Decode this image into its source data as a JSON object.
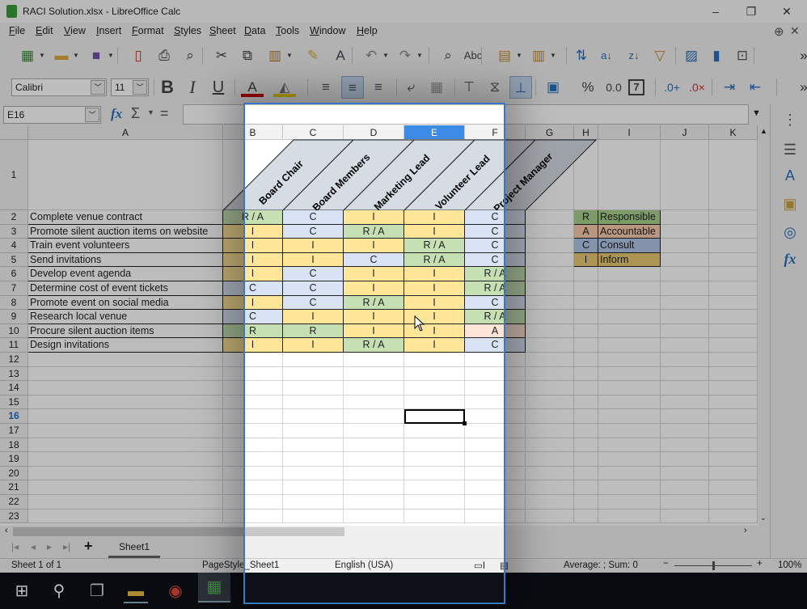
{
  "window": {
    "title": "RACI Solution.xlsx - LibreOffice Calc",
    "minimize": "–",
    "restore": "❐",
    "close": "✕"
  },
  "menu": [
    "File",
    "Edit",
    "View",
    "Insert",
    "Format",
    "Styles",
    "Sheet",
    "Data",
    "Tools",
    "Window",
    "Help"
  ],
  "toolbar1": [
    "new-spreadsheet-icon",
    "open-folder-icon",
    "save-icon",
    "export-pdf-icon",
    "print-icon",
    "print-preview-icon",
    "cut-icon",
    "copy-icon",
    "paste-icon",
    "clone-formatting-icon",
    "clear-formatting-icon",
    "undo-icon",
    "redo-icon",
    "find-replace-icon",
    "spelling-icon",
    "row-icon",
    "column-icon",
    "sort-icon",
    "sort-ascending-icon",
    "sort-descending-icon",
    "autofilter-icon",
    "insert-image-icon",
    "insert-chart-icon",
    "pivot-table-icon",
    "more-icon"
  ],
  "toolbar2": {
    "font_name": "Calibri",
    "font_size": "11",
    "icons": [
      "bold-icon",
      "italic-icon",
      "underline-icon",
      "font-color-icon",
      "highlight-icon",
      "align-left-icon",
      "align-center-icon",
      "align-right-icon",
      "wrap-text-icon",
      "merge-cells-icon",
      "align-top-icon",
      "align-middle-icon",
      "align-bottom-icon",
      "currency-icon",
      "percent-icon",
      "number-format-icon",
      "date-format-icon",
      "add-decimal-icon",
      "delete-decimal-icon",
      "increase-indent-icon",
      "decrease-indent-icon",
      "more-icon"
    ]
  },
  "formula_bar": {
    "cell_ref": "E16",
    "fx": "fx",
    "sum": "Σ",
    "equals": "=",
    "value": ""
  },
  "columns": [
    "A",
    "B",
    "C",
    "D",
    "E",
    "F",
    "G",
    "H",
    "I",
    "J",
    "K"
  ],
  "selected_column": "E",
  "selected_row": "16",
  "active_cell": "E16",
  "row_numbers": [
    "1",
    "2",
    "3",
    "4",
    "5",
    "6",
    "7",
    "8",
    "9",
    "10",
    "11",
    "12",
    "13",
    "14",
    "15",
    "16",
    "17",
    "18",
    "19",
    "20",
    "21",
    "22",
    "23"
  ],
  "roles": [
    "Board Chair",
    "Board Members",
    "Marketing Lead",
    "Volunteer Lead",
    "Project Manager"
  ],
  "tasks": [
    {
      "task": "Complete venue contract",
      "values": [
        "R / A",
        "C",
        "I",
        "I",
        "C"
      ]
    },
    {
      "task": "Promote silent auction items on website",
      "values": [
        "I",
        "C",
        "R / A",
        "I",
        "C"
      ]
    },
    {
      "task": "Train event volunteers",
      "values": [
        "I",
        "I",
        "I",
        "R / A",
        "C"
      ]
    },
    {
      "task": "Send invitations",
      "values": [
        "I",
        "I",
        "C",
        "R / A",
        "C"
      ]
    },
    {
      "task": "Develop event agenda",
      "values": [
        "I",
        "C",
        "I",
        "I",
        "R / A"
      ]
    },
    {
      "task": "Determine cost of event tickets",
      "values": [
        "C",
        "C",
        "I",
        "I",
        "R / A"
      ]
    },
    {
      "task": "Promote event on social media",
      "values": [
        "I",
        "C",
        "R / A",
        "I",
        "C"
      ]
    },
    {
      "task": "Research local venue",
      "values": [
        "C",
        "I",
        "I",
        "I",
        "R / A"
      ]
    },
    {
      "task": "Procure silent auction items",
      "values": [
        "R",
        "R",
        "I",
        "I",
        "A"
      ]
    },
    {
      "task": "Design invitations",
      "values": [
        "I",
        "I",
        "R / A",
        "I",
        "C"
      ]
    }
  ],
  "legend": [
    {
      "key": "R",
      "label": "Responsible"
    },
    {
      "key": "A",
      "label": "Accountable"
    },
    {
      "key": "C",
      "label": "Consult"
    },
    {
      "key": "I",
      "label": "Inform"
    }
  ],
  "colors": {
    "R / A": "#c6e0b4",
    "R": "#c6e0b4",
    "A": "#fce4d6",
    "C": "#dae3f3",
    "I": "#ffe699",
    "legend_R": "#a9d08e",
    "legend_A": "#f8cbad",
    "legend_C": "#b4c6e7",
    "legend_I": "#e8c872",
    "header": "#d6dce4",
    "accent": "#3b78c4"
  },
  "sheet_tabs": {
    "add": "+",
    "tabs": [
      "Sheet1"
    ]
  },
  "status": {
    "sheet": "Sheet 1 of 1",
    "page_style": "PageStyle_Sheet1",
    "language": "English (USA)",
    "summary": "Average: ; Sum: 0",
    "zoom": "100%",
    "zoom_minus": "−",
    "zoom_plus": "+"
  },
  "taskbar": [
    "windows-start-icon",
    "search-icon",
    "task-view-icon",
    "file-explorer-icon",
    "chrome-icon",
    "libreoffice-calc-icon"
  ]
}
